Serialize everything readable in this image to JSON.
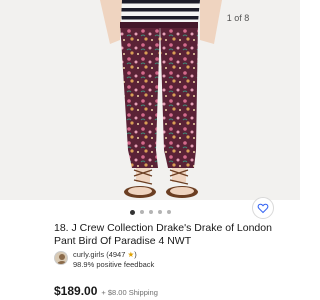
{
  "listing": {
    "image_counter": "1 of 8",
    "image_count": 8,
    "current_image": 1,
    "title": "18. J Crew Collection Drake's Drake of London Pant Bird Of Paradise 4 NWT",
    "seller": {
      "name_prefix": "curly.girls (",
      "feedback_count": "4947",
      "star": "★",
      "name_suffix": ")",
      "positive_feedback": "98.9% positive feedback"
    },
    "price": "$189.00",
    "shipping": "+ $8.00 Shipping"
  },
  "icons": {
    "favorite": "heart-icon",
    "seller_avatar": "avatar"
  },
  "colors": {
    "pants_base": "#5a2236",
    "pants_pattern_pink": "#d46a8c",
    "pants_pattern_orange": "#d99e55",
    "shirt_stripe": "#1c1c2a",
    "feedback_star": "#e0a100"
  }
}
